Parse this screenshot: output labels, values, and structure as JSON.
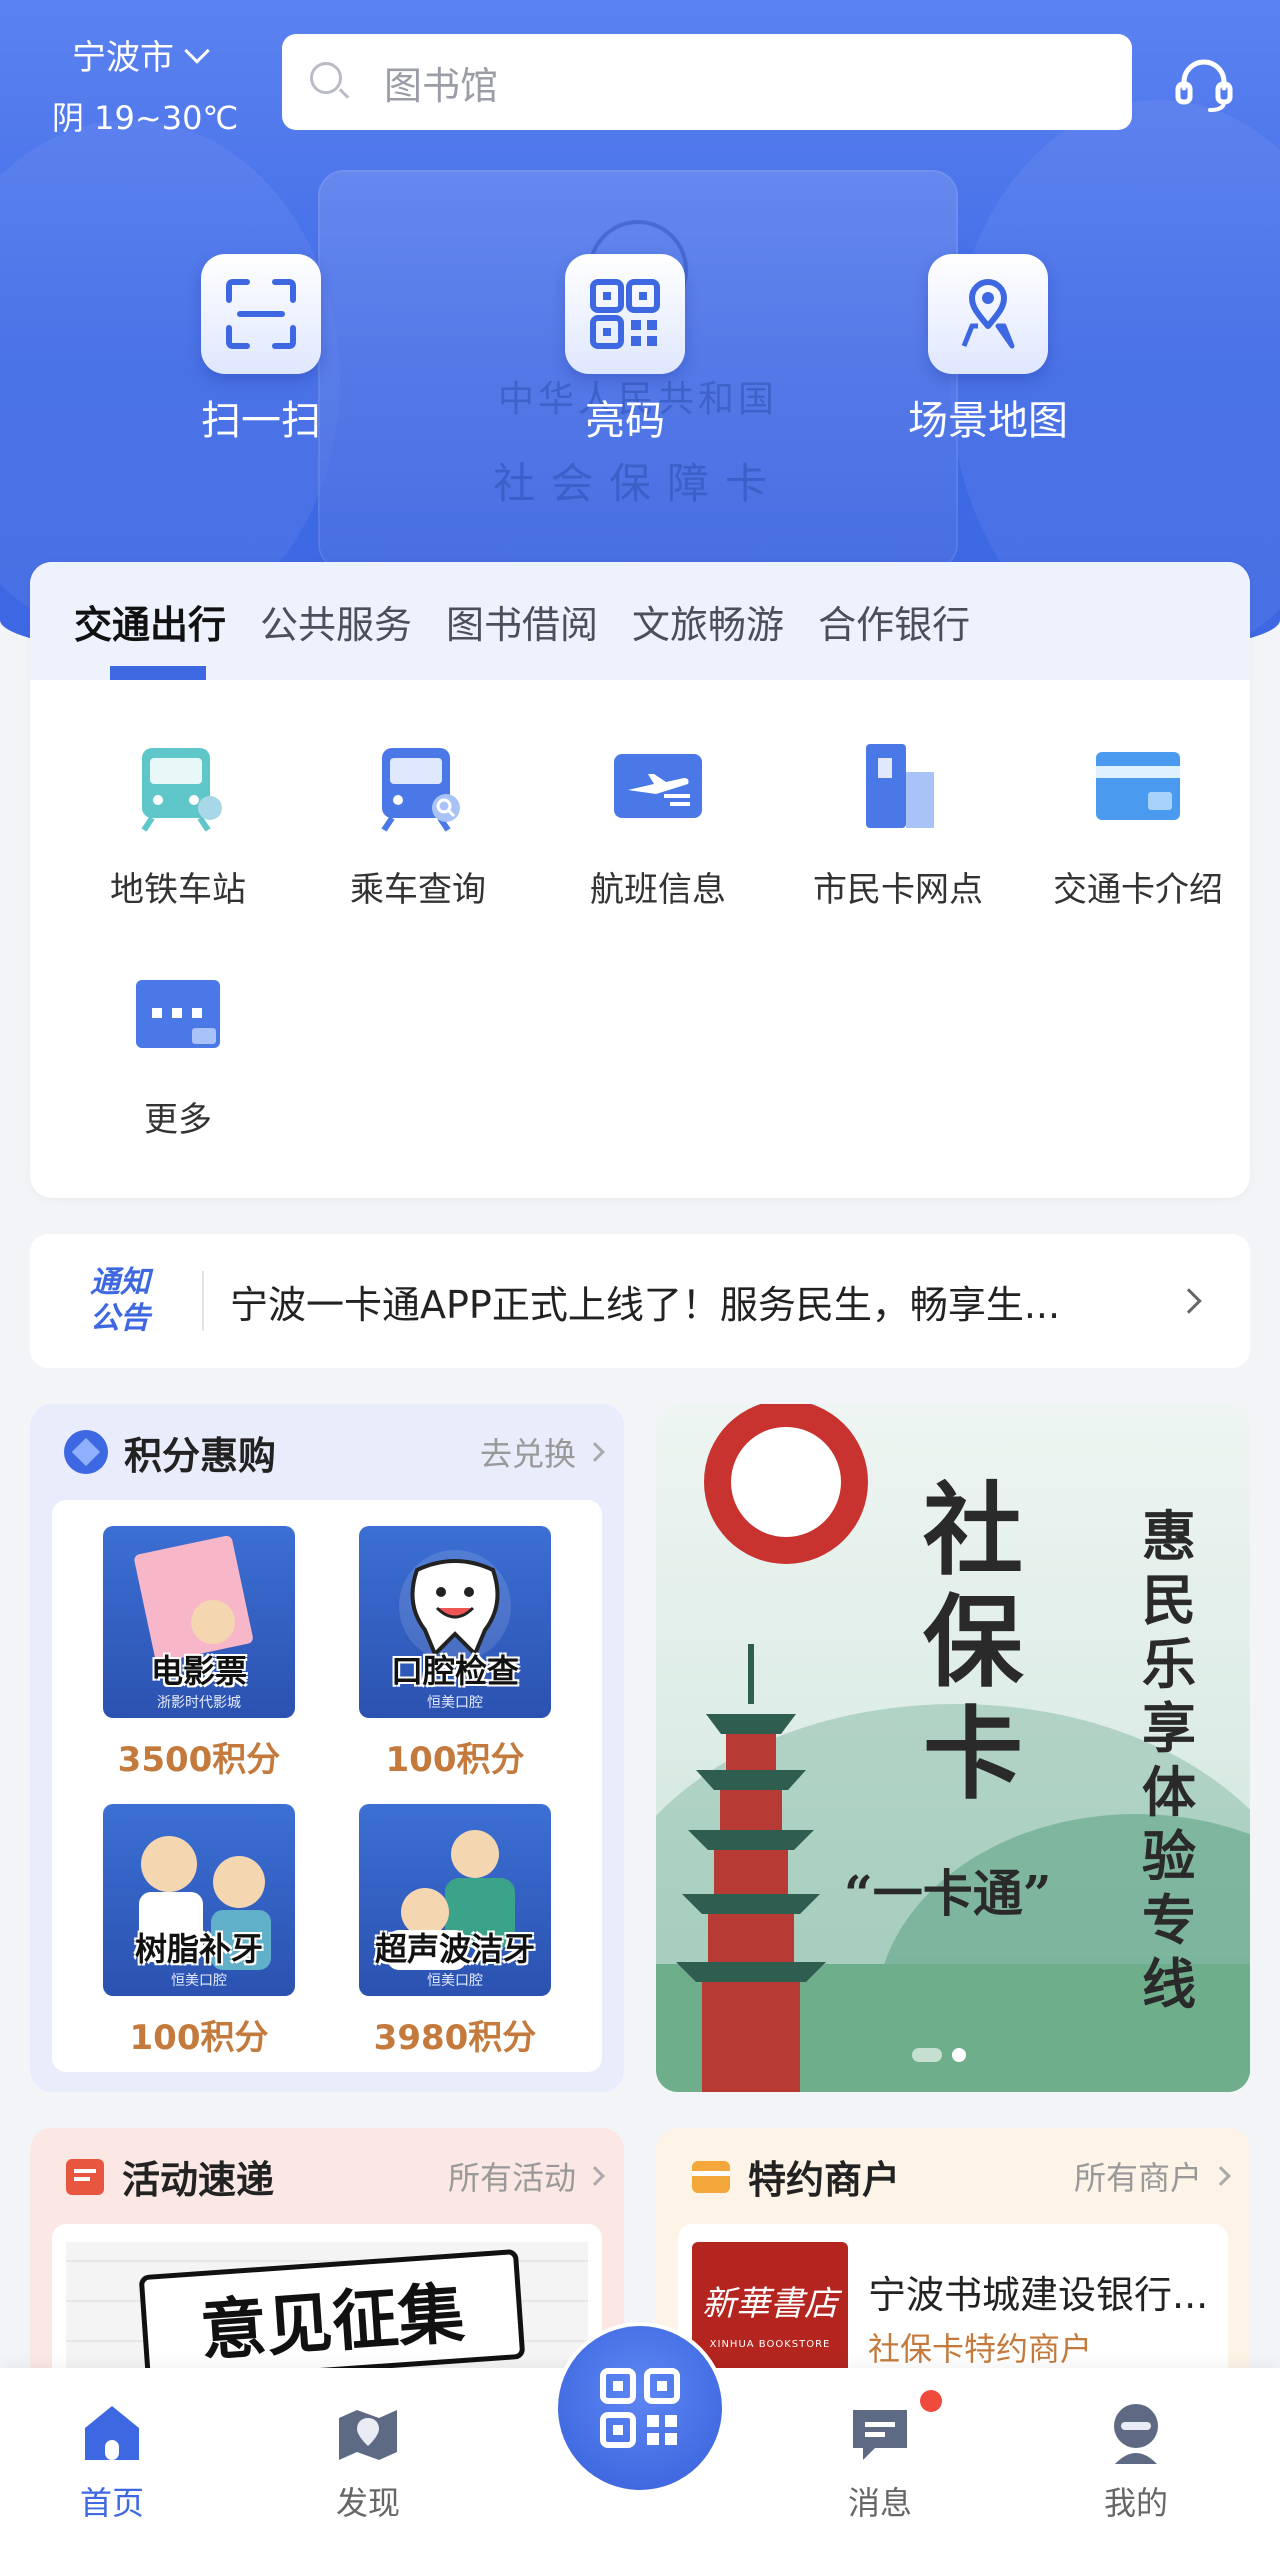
{
  "header": {
    "city": "宁波市",
    "weather": "阴 19~30℃",
    "search_placeholder": "图书馆"
  },
  "hero_card": {
    "line1": "中华人民共和国",
    "line2": "社会保障卡"
  },
  "quick_actions": [
    {
      "label": "扫一扫",
      "icon": "scan-icon"
    },
    {
      "label": "亮码",
      "icon": "qr-code-icon"
    },
    {
      "label": "场景地图",
      "icon": "map-pin-icon"
    }
  ],
  "tabs": [
    "交通出行",
    "公共服务",
    "图书借阅",
    "文旅畅游",
    "合作银行"
  ],
  "active_tab": 0,
  "services": [
    {
      "label": "地铁车站",
      "icon": "metro-icon"
    },
    {
      "label": "乘车查询",
      "icon": "bus-search-icon"
    },
    {
      "label": "航班信息",
      "icon": "flight-icon"
    },
    {
      "label": "市民卡网点",
      "icon": "building-icon"
    },
    {
      "label": "交通卡介绍",
      "icon": "card-icon"
    },
    {
      "label": "更多",
      "icon": "more-icon"
    }
  ],
  "notice": {
    "badge_line1": "通知",
    "badge_line2": "公告",
    "text": "宁波一卡通APP正式上线了！服务民生，畅享生..."
  },
  "points_panel": {
    "title": "积分惠购",
    "more": "去兑换",
    "products": [
      {
        "name": "电影票",
        "sub": "浙影时代影城",
        "price": "3500积分"
      },
      {
        "name": "口腔检查",
        "sub": "恒美口腔",
        "price": "100积分"
      },
      {
        "name": "树脂补牙",
        "sub": "恒美口腔",
        "price": "100积分"
      },
      {
        "name": "超声波洁牙",
        "sub": "恒美口腔",
        "price": "3980积分"
      }
    ]
  },
  "banner": {
    "big_text": "社保卡",
    "side_text": "惠民乐享体验专线",
    "quote": "“一卡通”"
  },
  "activity": {
    "title": "活动速递",
    "more": "所有活动",
    "image_text": "意见征集"
  },
  "merchants": {
    "title": "特约商户",
    "more": "所有商户",
    "logo_cn": "新華書店",
    "logo_en": "XINHUA  BOOKSTORE",
    "name": "宁波书城建设银行...",
    "type": "社保卡特约商户"
  },
  "bottom_nav": [
    {
      "label": "首页",
      "icon": "home-icon",
      "active": true
    },
    {
      "label": "发现",
      "icon": "discover-icon",
      "active": false
    },
    {
      "label": "消息",
      "icon": "message-icon",
      "active": false,
      "badge": true
    },
    {
      "label": "我的",
      "icon": "profile-icon",
      "active": false
    }
  ],
  "colors": {
    "primary": "#3e68e2",
    "price": "#c37a3c",
    "badge": "#ef4a3b"
  }
}
